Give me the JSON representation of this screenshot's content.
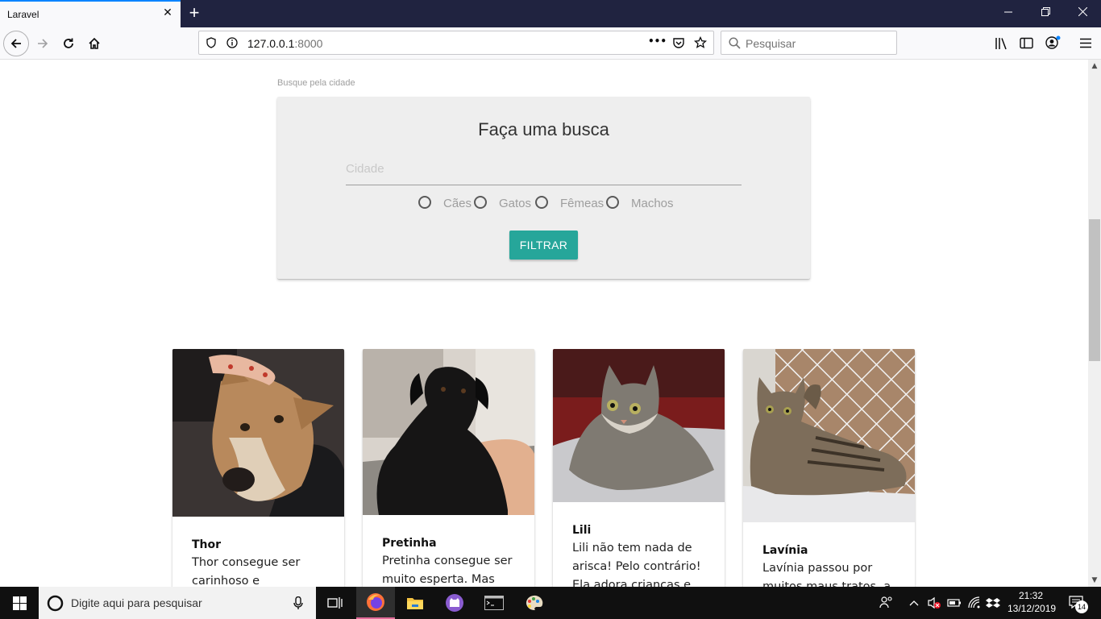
{
  "browser": {
    "tab_title": "Laravel",
    "close_glyph": "✕",
    "new_tab_glyph": "+",
    "url_host": "127.0.0.1",
    "url_port": ":8000",
    "page_actions_glyph": "•••",
    "search_placeholder": "Pesquisar"
  },
  "search_section": {
    "hint": "Busque pela cidade",
    "title": "Faça uma busca",
    "city_placeholder": "Cidade",
    "filters": [
      {
        "label": "Cães"
      },
      {
        "label": "Gatos"
      },
      {
        "label": "Fêmeas"
      },
      {
        "label": "Machos"
      }
    ],
    "filter_button": "FILTRAR",
    "accent_color": "#26a69a"
  },
  "pets": [
    {
      "name": "Thor",
      "desc_lines": [
        "Thor consegue ser",
        "carinhoso e aventureiro"
      ]
    },
    {
      "name": "Pretinha",
      "desc_lines": [
        "Pretinha consegue ser",
        "muito esperta. Mas tome"
      ]
    },
    {
      "name": "Lili",
      "desc_lines": [
        "Lili não tem nada de",
        "arisca! Pelo contrário!",
        "Ela adora crianças e ama"
      ]
    },
    {
      "name": "Lavínia",
      "desc_lines": [
        "Lavínia passou por",
        "muitos maus tratos, a"
      ]
    }
  ],
  "taskbar": {
    "search_placeholder": "Digite aqui para pesquisar",
    "time": "21:32",
    "date": "13/12/2019",
    "notification_count": "14"
  }
}
